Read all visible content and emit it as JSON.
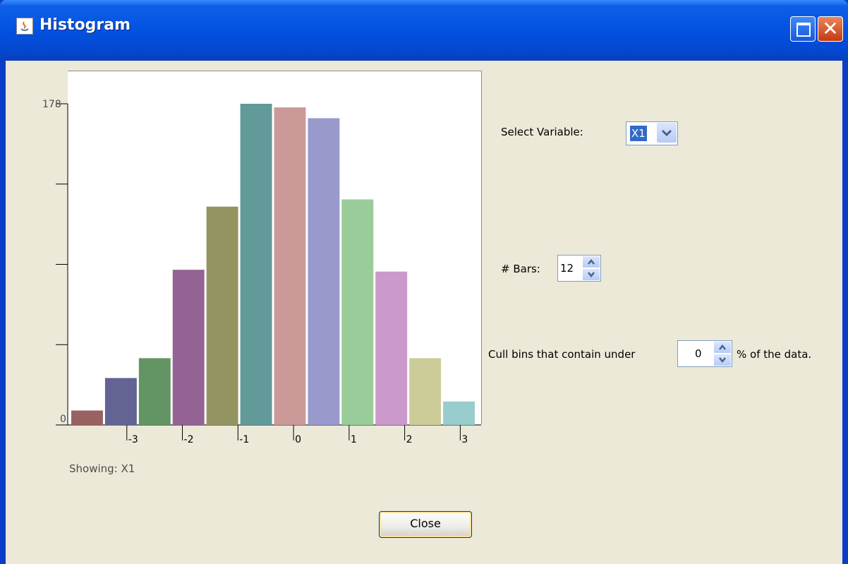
{
  "window": {
    "title": "Histogram",
    "maximize_glyph": "",
    "close_glyph": "✕"
  },
  "controls": {
    "select_variable_label": "Select Variable:",
    "variable_value": "X1",
    "bars_label": "# Bars:",
    "bars_value": "12",
    "cull_label": "Cull bins that contain under",
    "cull_value": "0",
    "cull_suffix": "% of the data."
  },
  "status_text": "Showing: X1",
  "close_button_label": "Close",
  "chart_data": {
    "type": "bar",
    "title": "",
    "xlabel": "",
    "ylabel": "",
    "y_max_label": "178",
    "y_min_label": "0",
    "ylim": [
      0,
      178
    ],
    "values": [
      8,
      26,
      37,
      86,
      121,
      178,
      176,
      170,
      125,
      85,
      37,
      13
    ],
    "colors": [
      "#996262",
      "#636394",
      "#639463",
      "#946394",
      "#949462",
      "#629999",
      "#cc9999",
      "#9999cc",
      "#99cc99",
      "#cc99cc",
      "#cccc99",
      "#99cccc"
    ],
    "x_ticks": [
      "-3",
      "-2",
      "-1",
      "0",
      "1",
      "2",
      "3"
    ],
    "x_range": [
      -4.0,
      3.3
    ],
    "x_tick_values": [
      -3,
      -2,
      -1,
      0,
      1,
      2,
      3
    ]
  }
}
